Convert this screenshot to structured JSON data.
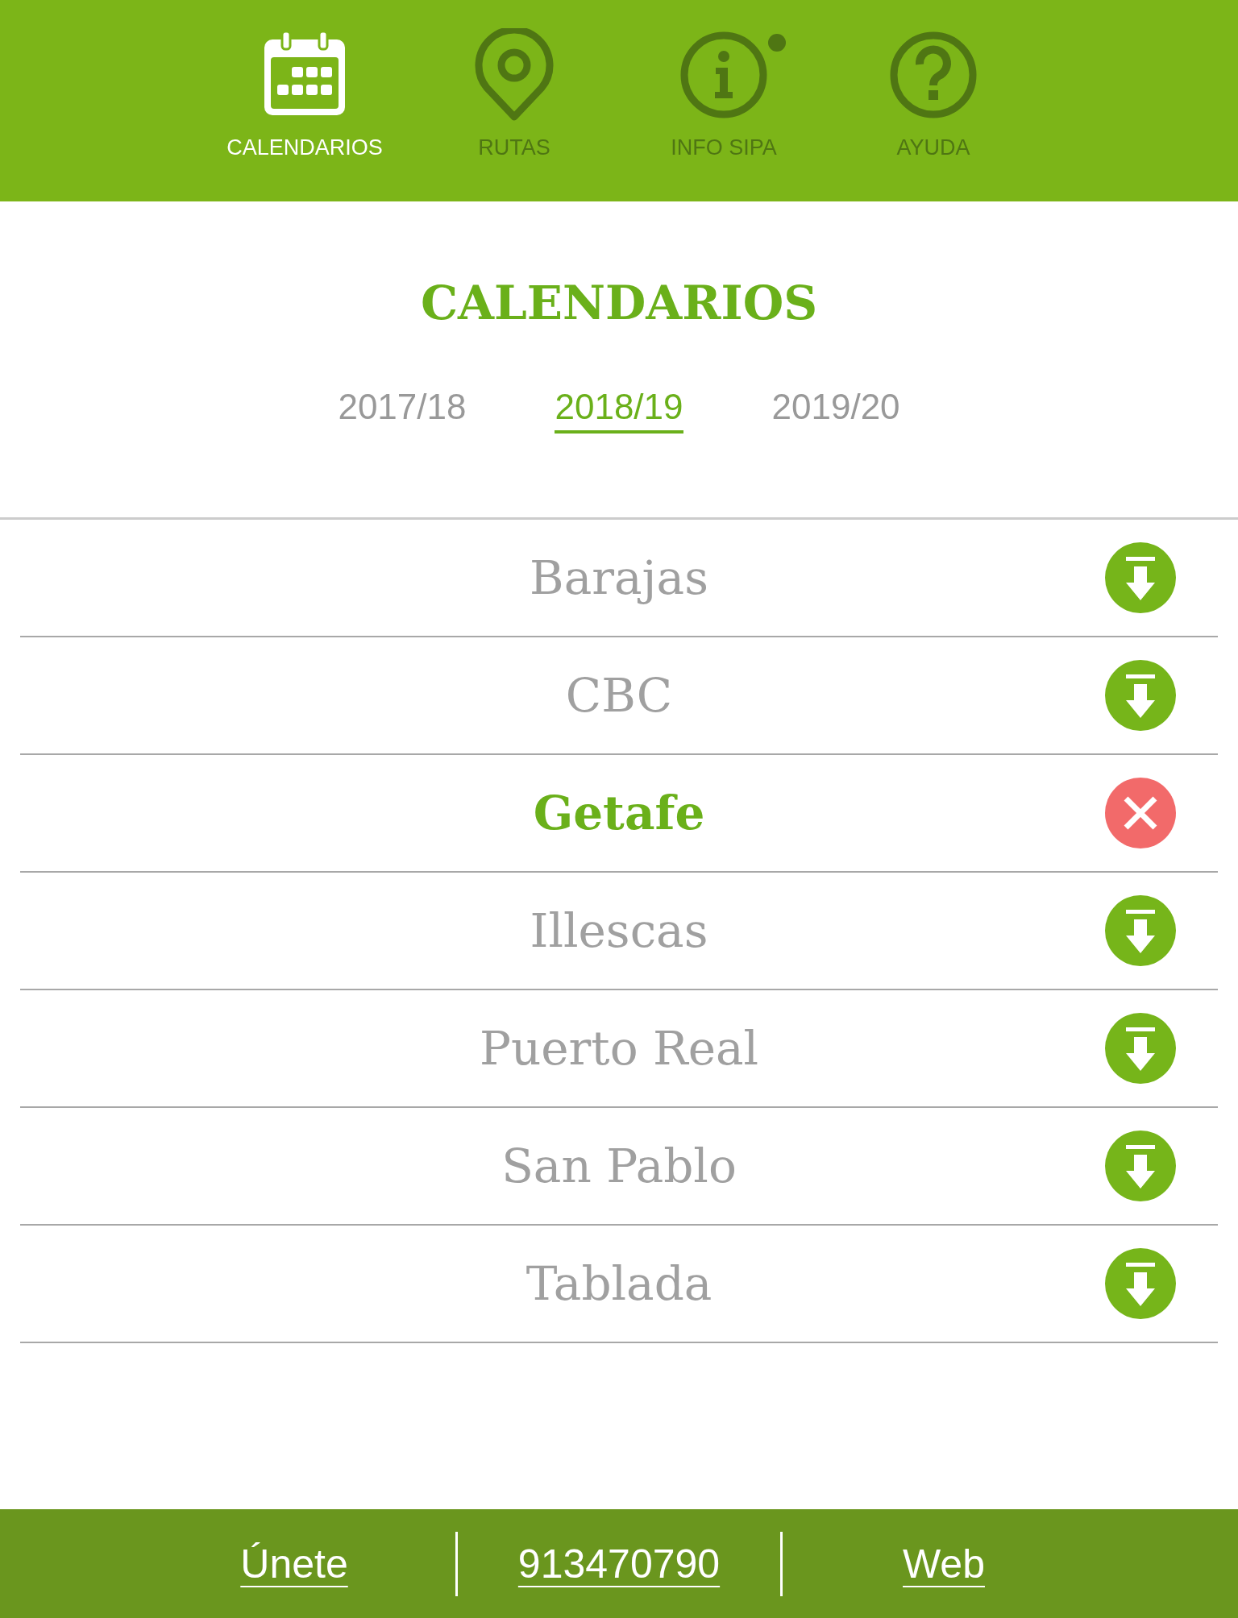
{
  "nav": [
    {
      "label": "CALENDARIOS",
      "kind": "calendar",
      "selected": true,
      "dot": false
    },
    {
      "label": "RUTAS",
      "kind": "pin",
      "selected": false,
      "dot": false
    },
    {
      "label": "INFO SIPA",
      "kind": "info",
      "selected": false,
      "dot": true
    },
    {
      "label": "AYUDA",
      "kind": "help",
      "selected": false,
      "dot": false
    }
  ],
  "title": "CALENDARIOS",
  "years": [
    {
      "label": "2017/18",
      "selected": false
    },
    {
      "label": "2018/19",
      "selected": true
    },
    {
      "label": "2019/20",
      "selected": false
    }
  ],
  "locations": [
    {
      "name": "Barajas",
      "selected": false
    },
    {
      "name": "CBC",
      "selected": false
    },
    {
      "name": "Getafe",
      "selected": true
    },
    {
      "name": "Illescas",
      "selected": false
    },
    {
      "name": "Puerto Real",
      "selected": false
    },
    {
      "name": "San Pablo",
      "selected": false
    },
    {
      "name": "Tablada",
      "selected": false
    }
  ],
  "footer": [
    "Únete",
    "913470790",
    "Web"
  ]
}
